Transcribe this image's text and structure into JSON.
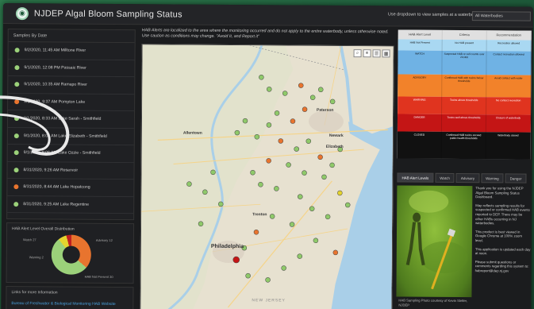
{
  "app": {
    "title": "NJDEP Algal Bloom Sampling Status"
  },
  "header": {
    "dropdown_label": "Use dropdown to view samples at a waterbody:",
    "dropdown_value": "All Waterbodies"
  },
  "samples_panel": {
    "title": "Samples By Date",
    "items": [
      {
        "text": "9/2/2020, 11:45 AM  Milltone River",
        "color": "#9bd17a"
      },
      {
        "text": "9/1/2020, 12:08 PM  Passaic River",
        "color": "#9bd17a"
      },
      {
        "text": "9/1/2020, 10:35 AM  Ramapo River",
        "color": "#9bd17a"
      },
      {
        "text": "9/1/2020, 9:37 AM  Pompton Lake",
        "color": "#e8742e"
      },
      {
        "text": "9/1/2020, 8:33 AM  Lake Sarah - Smithfield",
        "color": "#9bd17a"
      },
      {
        "text": "9/1/2020, 8:01 AM  Lake Elizabeth - Smithfield",
        "color": "#9bd17a"
      },
      {
        "text": "9/1/2020, 8:06 AM  Lake Ozzie - Smithfield",
        "color": "#9bd17a"
      },
      {
        "text": "8/31/2020, 9:26 AM  Reservoir",
        "color": "#9bd17a"
      },
      {
        "text": "8/31/2020, 8:44 AM  Lake Hopatcong",
        "color": "#e8742e"
      },
      {
        "text": "8/31/2020, 9:25 AM  Lake Regentine",
        "color": "#9bd17a"
      }
    ]
  },
  "distribution": {
    "title": "HAB Alert Level Overall Distribution",
    "labels": {
      "watch": "Watch 27",
      "advisory": "Advisory 12",
      "warning": "Warning 2",
      "none": "HAB Not Present 30"
    }
  },
  "links": {
    "title": "Links for more Information",
    "link": "Bureau of Freshwater & Biological Monitoring HAB Website"
  },
  "map": {
    "note": "HAB Alerts are localized to the area where the monitoring occurred and do not apply to the entire waterbody, unless otherwise noted. Use caution as conditions may change. \"Avoid It, and Report it\"",
    "labels": {
      "paterson": "Paterson",
      "newark": "Newark",
      "elizabeth": "Elizabeth",
      "allentown": "Allentown",
      "trenton": "Trenton",
      "philadelphia": "Philadelphia",
      "new_jersey": "NEW JERSEY"
    }
  },
  "alert_table": {
    "headers": [
      "HAB Alert Level",
      "Criteria",
      "Recommendation"
    ],
    "rows": [
      {
        "color": "#a9d8f2",
        "cells": [
          "HAB Not Present",
          "No HAB present",
          "Recreation allowed"
        ]
      },
      {
        "color": "#6fb2e4",
        "cells": [
          "WATCH",
          "Suspected HAB or cell counts over 20,000",
          "Contact recreation allowed"
        ]
      },
      {
        "color": "#f2822a",
        "cells": [
          "ADVISORY",
          "Confirmed HAB with toxins below thresholds",
          "Avoid contact with water"
        ]
      },
      {
        "color": "#e0341f",
        "cells": [
          "WARNING",
          "Toxins above thresholds",
          "No contact recreation"
        ]
      },
      {
        "color": "#c41515",
        "cells": [
          "DANGER",
          "Toxins well above thresholds",
          "Closure of waterbody"
        ]
      },
      {
        "color": "#111111",
        "cells": [
          "CLOSED",
          "Confirmed HAB toxins exceed public health thresholds",
          "Waterbody closed"
        ]
      }
    ]
  },
  "tabs": [
    "HAB Alert Levels",
    "Watch",
    "Advisory",
    "Warning",
    "Danger"
  ],
  "photo": {
    "caption": "HAB Sampling Photo courtesy of Kevin Steller, NJDEP"
  },
  "info": {
    "p1": "Thank you for using the NJDEP Algal Bloom Sampling Status Dashboard.",
    "p2": "Map reflects sampling results for suspected or confirmed HAB events reported to DEP. There may be other HABs occurring in NJ waterbodies.",
    "p3": "This product is best viewed in Google Chrome at 100% zoom level.",
    "p4": "This application is updated each day at noon.",
    "p5": "Please submit questions or comments regarding this system to: habreport@dep.nj.gov"
  }
}
